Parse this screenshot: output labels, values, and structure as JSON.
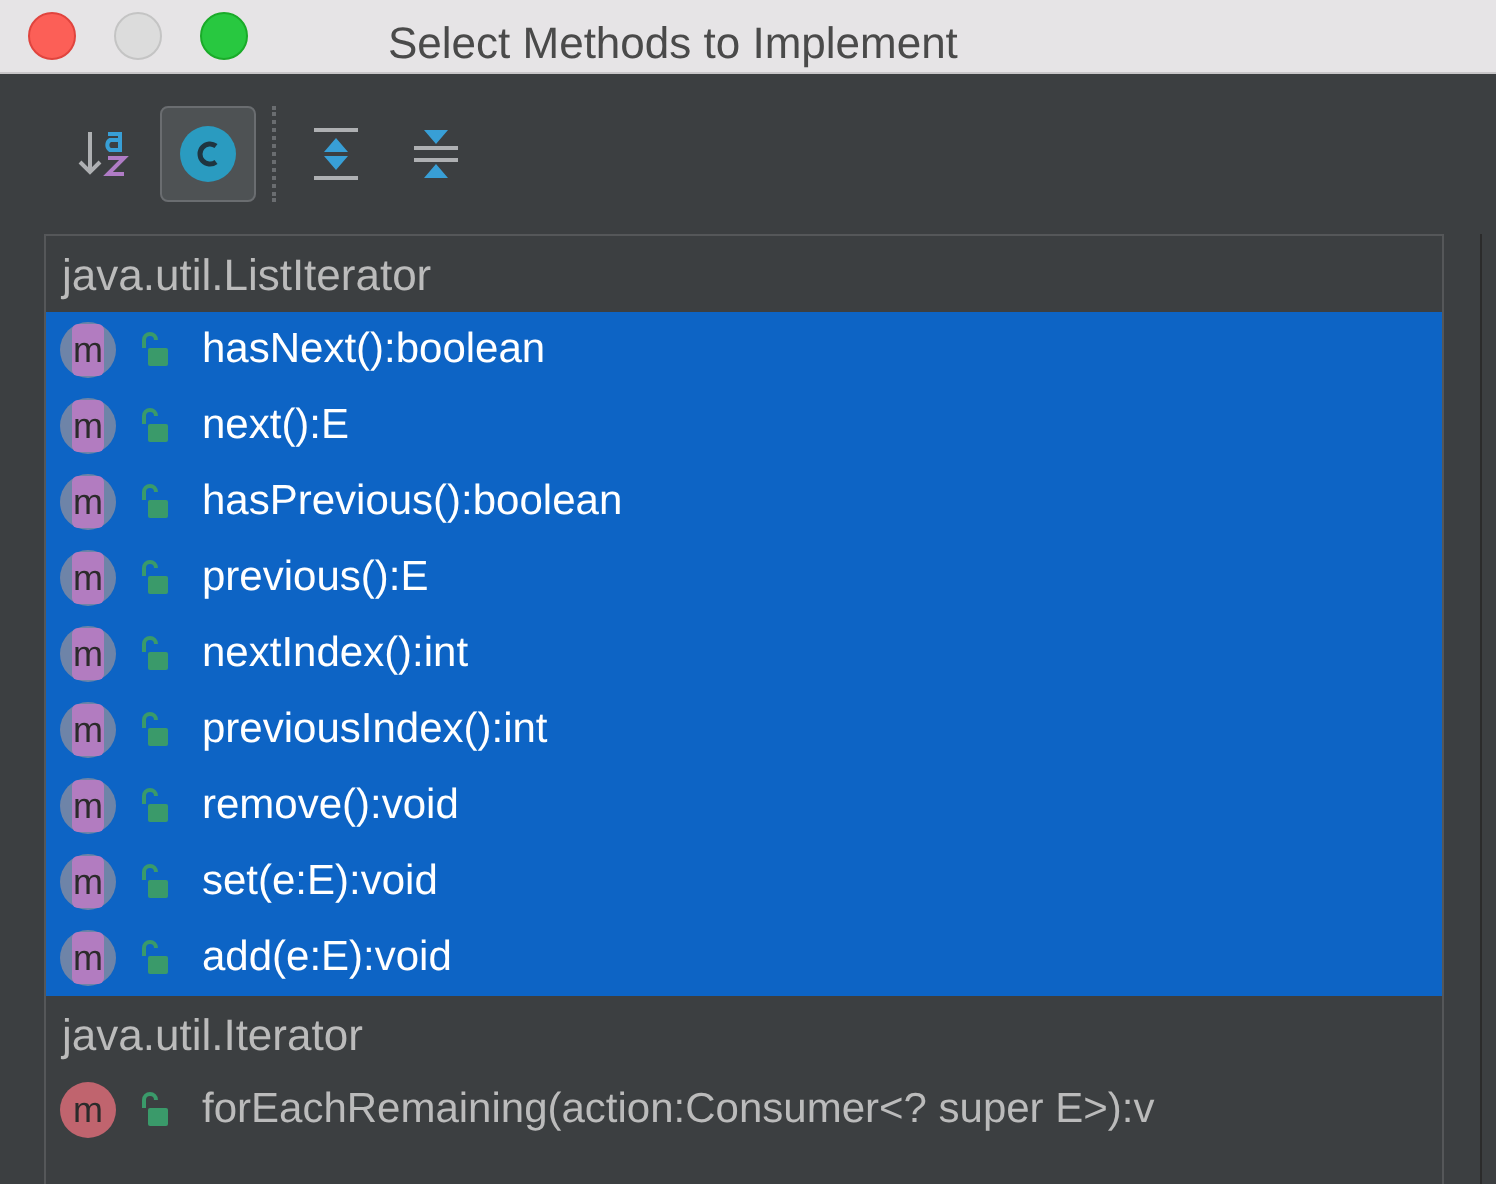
{
  "window": {
    "title": "Select Methods to Implement"
  },
  "toolbar": [
    {
      "kind": "sort",
      "selected": false
    },
    {
      "kind": "classes",
      "selected": true
    },
    {
      "kind": "expand",
      "selected": false
    },
    {
      "kind": "collapse",
      "selected": false
    }
  ],
  "groups": [
    {
      "name": "java.util.ListIterator",
      "methods": [
        {
          "badge": "m",
          "label": "hasNext():boolean",
          "selected": true
        },
        {
          "badge": "m",
          "label": "next():E",
          "selected": true
        },
        {
          "badge": "m",
          "label": "hasPrevious():boolean",
          "selected": true
        },
        {
          "badge": "m",
          "label": "previous():E",
          "selected": true
        },
        {
          "badge": "m",
          "label": "nextIndex():int",
          "selected": true
        },
        {
          "badge": "m",
          "label": "previousIndex():int",
          "selected": true
        },
        {
          "badge": "m",
          "label": "remove():void",
          "selected": true
        },
        {
          "badge": "m",
          "label": "set(e:E):void",
          "selected": true
        },
        {
          "badge": "m",
          "label": "add(e:E):void",
          "selected": true
        }
      ]
    },
    {
      "name": "java.util.Iterator",
      "methods": [
        {
          "badge": "m",
          "label": "forEachRemaining(action:Consumer<? super E>):v",
          "selected": false
        }
      ]
    }
  ]
}
